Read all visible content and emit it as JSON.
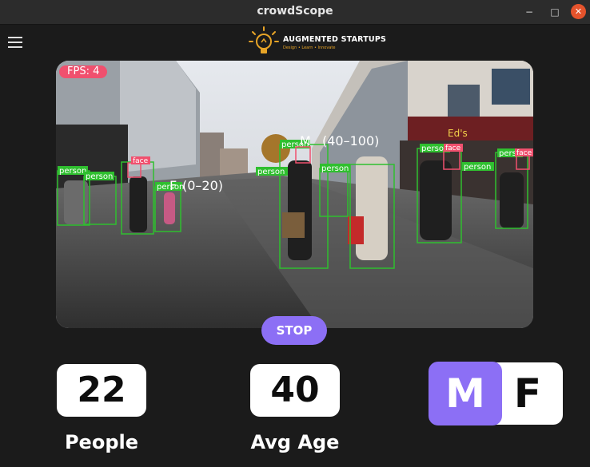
{
  "window": {
    "title": "crowdScope",
    "minimize_glyph": "−",
    "maximize_glyph": "□",
    "close_glyph": "✕"
  },
  "logo": {
    "name": "AUGMENTED STARTUPS",
    "tagline": "Design • Learn • Innovate"
  },
  "video": {
    "fps_label": "FPS: 4",
    "detections": {
      "person_label": "person",
      "face_label": "face",
      "age_range_left": "(0–20)",
      "age_range_center": "(40–100)",
      "gender_left": "F",
      "gender_center": "M"
    },
    "shop_sign": "Ed's"
  },
  "controls": {
    "stop_label": "STOP"
  },
  "stats": {
    "people_count": "22",
    "people_label": "People",
    "avg_age": "40",
    "avg_age_label": "Avg Age",
    "gender_m": "M",
    "gender_f": "F",
    "active_gender": "M"
  },
  "colors": {
    "accent": "#8c6ff5",
    "fps_badge": "#f0506e",
    "person_box": "#2fbf2f",
    "face_box": "#f0506e",
    "background": "#1b1b1b"
  }
}
